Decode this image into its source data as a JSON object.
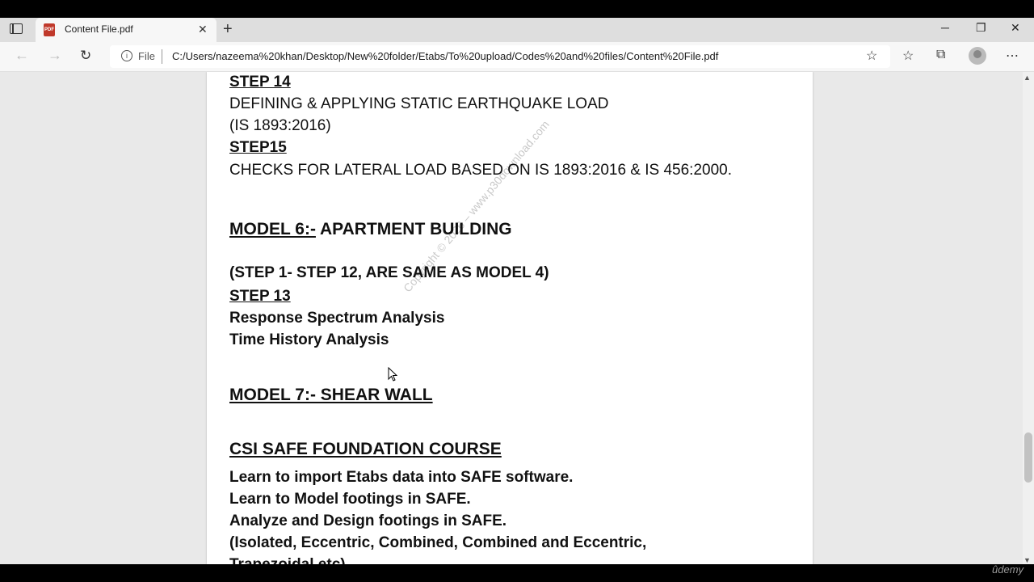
{
  "browser": {
    "tab_title": "Content File.pdf",
    "tab_icon_text": "PDF",
    "new_tab_symbol": "+",
    "window_controls": [
      "─",
      "❐",
      "✕"
    ],
    "file_label": "File",
    "url": "C:/Users/nazeema%20khan/Desktop/New%20folder/Etabs/To%20upload/Codes%20and%20files/Content%20File.pdf",
    "icons": [
      "back-icon",
      "forward-icon",
      "refresh-icon",
      "info-icon",
      "favorite-add-icon",
      "favorites-icon",
      "collections-icon",
      "profile-icon",
      "more-icon"
    ]
  },
  "document": {
    "step14_heading": "STEP 14",
    "step14_line1": "DEFINING & APPLYING STATIC EARTHQUAKE LOAD",
    "step14_line2": "(IS 1893:2016)",
    "step15_heading": "STEP15",
    "step15_line1": "CHECKS FOR LATERAL LOAD  BASED ON IS 1893:2016 & IS 456:2000.",
    "model6_prefix": "MODEL 6:-",
    "model6_title": " APARTMENT  BUILDING",
    "model6_note": "(STEP 1-  STEP 12, ARE SAME AS MODEL 4)",
    "step13_heading": "STEP 13",
    "step13_item1": "Response Spectrum Analysis",
    "step13_item2": "Time History Analysis",
    "model7_heading": "MODEL 7:- SHEAR WALL",
    "safe_heading": "CSI SAFE FOUNDATION COURSE",
    "safe_item1": "Learn to import Etabs data into SAFE software.",
    "safe_item2": "Learn to Model footings in SAFE.",
    "safe_item3": "Analyze and Design footings in SAFE.",
    "safe_item4": "(Isolated, Eccentric, Combined, Combined and Eccentric,",
    "safe_item5": "Trapezoidal etc)"
  },
  "watermark": "Copyright © 2026 – www.p30download.com",
  "overlay_brand": "ûdemy"
}
